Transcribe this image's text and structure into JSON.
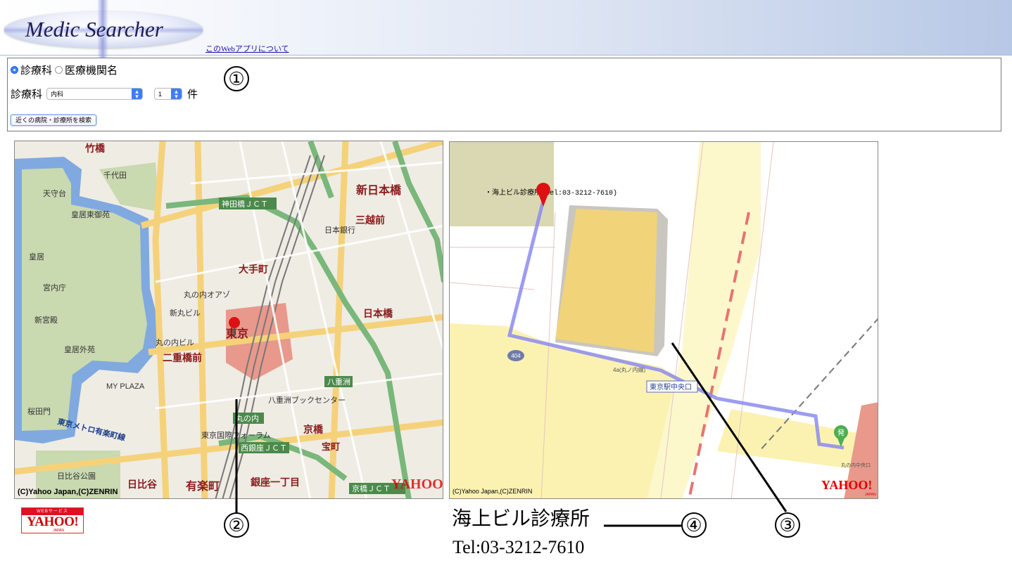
{
  "header": {
    "logo_text": "Medic Searcher",
    "about_link": "このWebアプリについて"
  },
  "search_form": {
    "mode_options": [
      {
        "label": "診療科",
        "selected": true
      },
      {
        "label": "医療機関名",
        "selected": false
      }
    ],
    "department_label": "診療科",
    "department_value": "内科",
    "count_value": "1",
    "count_unit": "件",
    "search_button": "近くの病院・診療所を検索"
  },
  "overview_map": {
    "copyright": "(C)Yahoo Japan,(C)ZENRIN",
    "logo": "YAHOO!",
    "labels": {
      "shin_nihonbashi": "新日本橋",
      "mitsukoshimae": "三越前",
      "otemachi": "大手町",
      "tokyo": "東京",
      "nihonbashi": "日本橋",
      "nijubashimae": "二重橋前",
      "yurakucho": "有楽町",
      "kyobashi": "京橋",
      "hibiya": "日比谷",
      "ginza_itchome": "銀座一丁目",
      "takebashi": "竹橋",
      "kanda_jct": "神田橋ＪＣＴ",
      "nishiginza_jct": "西銀座ＪＣＴ",
      "kyobashi_jct": "京橋ＪＣＴ",
      "yaesu": "八重洲",
      "takaracho": "宝町",
      "marunouchi": "丸の内",
      "chiyoda": "千代田",
      "kokyo": "皇居",
      "kokyo_higashi": "皇居東御苑",
      "kokyo_gaien": "皇居外苑",
      "shin_maru": "新丸ビル",
      "maru_biru": "丸の内ビル",
      "oazo": "丸の内オアゾ",
      "nihon_ginko": "日本銀行",
      "tokyo_forum": "東京国際フォーラム",
      "hibiya_koen": "日比谷公園",
      "tenshudai": "天守台",
      "kunaicho": "宮内庁",
      "shin_kyuden": "新宮殿",
      "sakuradamon": "桜田門",
      "mikado_line": "東京メトロ有楽町線",
      "yaesu_book": "八重洲ブックセンター",
      "my_plaza": "MY PLAZA"
    }
  },
  "detail_map": {
    "copyright": "(C)Yahoo Japan,(C)ZENRIN",
    "logo": "YAHOO!",
    "logo_sub": "JAPAN",
    "clinic_label": "・海上ビル診療所(tel:03-3212-7610)",
    "exit_label": "東京駅中央口",
    "route_number": "404",
    "lane_label": "4a(丸ノ内線)",
    "start_marker": "発",
    "bottom_right_label": "丸の内中央口"
  },
  "yahoo_badge": {
    "top": "WEBサービス",
    "word": "YAHOO!",
    "sub": "JAPAN"
  },
  "result": {
    "name": "海上ビル診療所",
    "tel": "Tel:03-3212-7610"
  },
  "callouts": [
    "①",
    "②",
    "③",
    "④"
  ]
}
